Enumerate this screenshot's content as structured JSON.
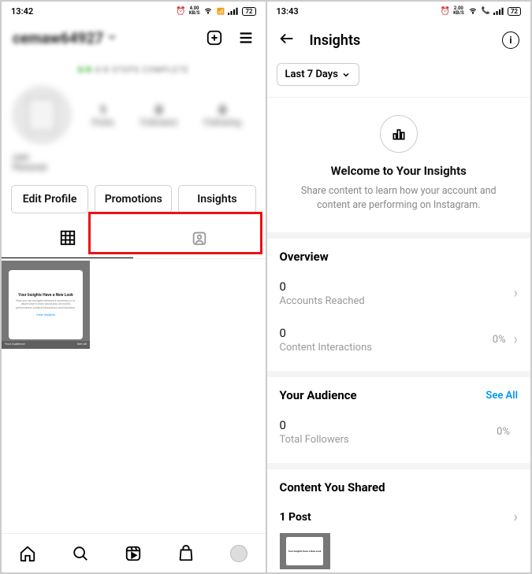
{
  "left": {
    "status": {
      "time": "13:42",
      "net_speed": "4.00",
      "net_unit": "KB/S",
      "battery": "72"
    },
    "username": "cemaw64927",
    "steps": "0/8 STEPS COMPLETE",
    "stats": [
      {
        "n": "1",
        "l": "Posts"
      },
      {
        "n": "0",
        "l": "Followers"
      },
      {
        "n": "0",
        "l": "Following"
      }
    ],
    "bio_line1": "user",
    "bio_line2": "Personal",
    "actions": {
      "edit": "Edit Profile",
      "promotions": "Promotions",
      "insights": "Insights"
    },
    "thumb": {
      "title": "Your Insights Have a New Look",
      "body": "Now you can navigate between a summary or in-depth view to learn about your account's performance, content interactions and followers.",
      "cta": "View Insights",
      "footer_l": "Your Audience",
      "footer_r": "See All"
    }
  },
  "right": {
    "status": {
      "time": "13:43",
      "net_speed": "2.00",
      "net_unit": "KB/S",
      "battery": "72"
    },
    "title": "Insights",
    "chip": "Last 7 Days",
    "welcome": {
      "title": "Welcome to Your Insights",
      "subtitle": "Share content to learn how your account and content are performing on Instagram."
    },
    "overview": {
      "title": "Overview",
      "reached": {
        "val": "0",
        "label": "Accounts Reached"
      },
      "interactions": {
        "val": "0",
        "label": "Content Interactions",
        "pct": "0%"
      }
    },
    "audience": {
      "title": "Your Audience",
      "see_all": "See All",
      "followers": {
        "val": "0",
        "label": "Total Followers",
        "pct": "0%"
      }
    },
    "shared": {
      "title": "Content You Shared",
      "post_count": "1 Post"
    }
  }
}
